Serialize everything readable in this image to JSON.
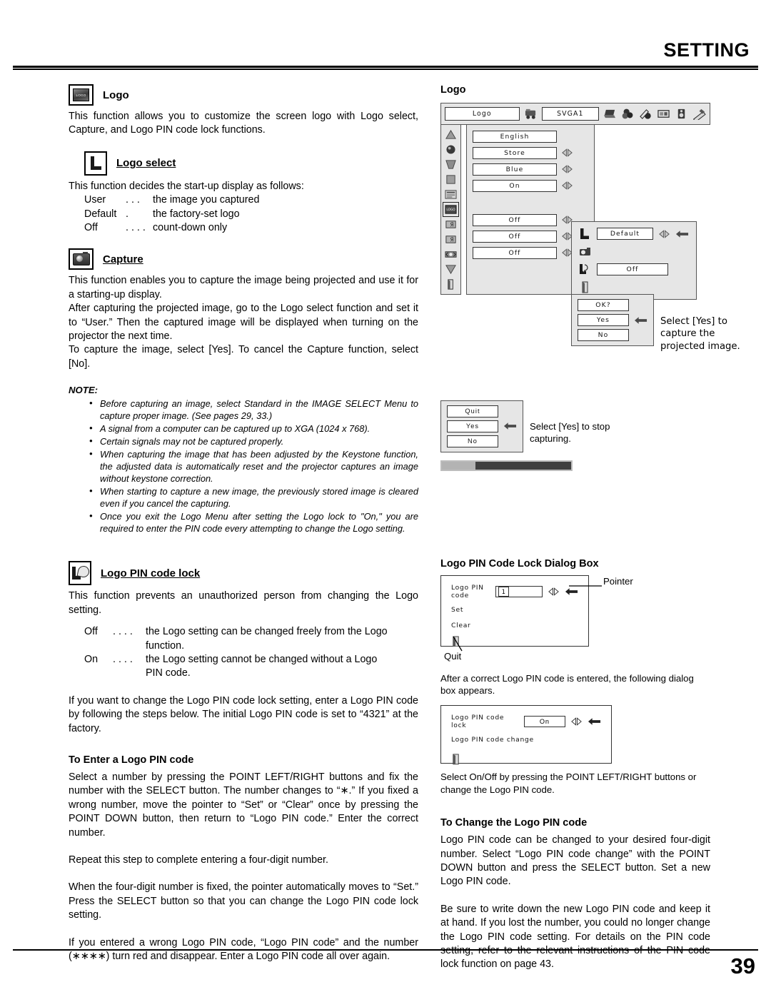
{
  "header": {
    "title": "SETTING"
  },
  "footer": {
    "page_number": "39"
  },
  "left": {
    "logo": {
      "icon": "logo-badge-icon",
      "title": "Logo",
      "paragraph": "This function allows you to customize the screen logo with Logo select, Capture, and Logo PIN code lock functions."
    },
    "logo_select": {
      "icon": "logo-select-L-icon",
      "title": "Logo select",
      "intro": "This function decides the start-up display as follows:",
      "options": [
        {
          "key": "User",
          "dots": ". . .",
          "desc": "the image you captured"
        },
        {
          "key": "Default",
          "dots": ".",
          "desc": "the factory-set logo"
        },
        {
          "key": "Off",
          "dots": ". . . .",
          "desc": "count-down only"
        }
      ]
    },
    "capture": {
      "icon": "camera-icon",
      "title": "Capture",
      "paragraphs": [
        "This function enables you to capture the image being projected and use it for a starting-up display.",
        "After capturing the projected image, go to the Logo select function and set it to “User.” Then the captured image will be displayed when turning on the projector the next time.",
        "To capture the image, select [Yes]. To cancel the Capture function, select [No]."
      ]
    },
    "note": {
      "title": "NOTE:",
      "items": [
        "Before capturing an image, select Standard in the IMAGE SELECT Menu to capture proper image. (See pages 29, 33.)",
        "A signal from a computer can be captured up to XGA (1024 x 768).",
        "Certain signals may not be captured properly.",
        "When capturing the image that has been adjusted by the Keystone function, the adjusted data is automatically reset and the projector captures an image without keystone correction.",
        "When starting to capture a new image, the previously stored image is cleared even if you cancel the capturing.",
        "Once you exit the Logo Menu after setting the Logo lock to \"On,\" you are required to enter the PIN code every attempting to change the Logo setting."
      ]
    },
    "pin_lock": {
      "icon": "logo-pin-code-lock-icon",
      "title": "Logo PIN code lock",
      "paragraph": "This function prevents an unauthorized person from changing the Logo setting.",
      "options": [
        {
          "key": "Off",
          "dots": ". . . .",
          "desc": "the Logo setting can be changed freely from the Logo",
          "cont": "function."
        },
        {
          "key": "On",
          "dots": ". . . .",
          "desc": "the Logo setting cannot be changed without a Logo",
          "cont": "PIN code."
        }
      ],
      "paragraph2": "If you want to change the Logo PIN code lock setting, enter a Logo PIN code by following the steps below. The initial Logo PIN code is set to “4321” at the factory."
    },
    "enter_pin": {
      "title": "To Enter a Logo PIN code",
      "paragraphs": [
        "Select a number by pressing the POINT LEFT/RIGHT buttons and fix the number with the SELECT button. The number changes to “∗.” If you fixed a wrong number, move the pointer to “Set” or “Clear” once by pressing the POINT DOWN button, then return to “Logo PIN code.” Enter the correct number.",
        "Repeat this step to complete entering a four-digit number.",
        "When the four-digit number is fixed, the pointer automatically moves to “Set.” Press the SELECT button so that you can change the Logo PIN code lock setting.",
        "If you entered a wrong Logo PIN code, “Logo PIN code” and the number (∗∗∗∗) turn red and disappear. Enter a Logo PIN code all over again."
      ]
    }
  },
  "right": {
    "osd_caption": "Logo",
    "osd": {
      "topbar": {
        "menu_title": "Logo",
        "source": "SVGA1",
        "icons": [
          "projector-icon",
          "computer-icon",
          "color-icon",
          "image-adjust-icon",
          "screen-icon",
          "sound-icon",
          "setting-icon"
        ]
      },
      "rail_icons": [
        "up-arrow-icon",
        "language-globe-icon",
        "keystone-icon",
        "background-icon",
        "display-icon",
        "logo-icon",
        "ceiling-icon",
        "rear-icon",
        "terminal-icon",
        "down-arrow-icon",
        "quit-icon"
      ],
      "rows": [
        {
          "value": "English",
          "arrows": false
        },
        {
          "value": "Store",
          "arrows": true
        },
        {
          "value": "Blue",
          "arrows": true
        },
        {
          "value": "On",
          "arrows": true
        },
        {
          "value": "Off",
          "arrows": true
        },
        {
          "value": "Off",
          "arrows": true
        },
        {
          "value": "Off",
          "arrows": true
        }
      ],
      "sub_dialog": {
        "rows": [
          {
            "icon": "logo-select-L-icon",
            "value": "Default",
            "arrows": true,
            "pointer": true
          },
          {
            "icon": "camera-icon",
            "value": "",
            "arrows": false,
            "pointer": false
          },
          {
            "icon": "logo-pin-code-lock-icon",
            "value": "Off",
            "arrows": false,
            "pointer": false
          },
          {
            "icon": "quit-icon",
            "value": "",
            "arrows": false,
            "pointer": false
          }
        ]
      },
      "ok_dialog": {
        "title": "OK?",
        "yes": "Yes",
        "no": "No",
        "pointer": true,
        "note": "Select [Yes] to capture the projected image."
      },
      "quit_dialog": {
        "title": "Quit",
        "yes": "Yes",
        "no": "No",
        "pointer": true,
        "note": "Select [Yes] to stop capturing."
      },
      "progress_percent": 26
    },
    "pin_dialog_section": {
      "heading": "Logo PIN Code Lock Dialog Box",
      "dialog": {
        "field_label": "Logo PIN code",
        "field_value": "1",
        "rows": [
          "Set",
          "Clear"
        ],
        "quit_icon": "quit-icon"
      },
      "pointer_label": "Pointer",
      "quit_label": "Quit"
    },
    "after_pin": {
      "paragraph": "After a correct Logo PIN code is entered, the following dialog box appears.",
      "dialog": {
        "row1_label": "Logo PIN code lock",
        "row1_value": "On",
        "row2_label": "Logo PIN code change",
        "quit_icon": "quit-icon"
      },
      "paragraph2": "Select On/Off by pressing the POINT LEFT/RIGHT buttons or change the Logo PIN code."
    },
    "change_pin": {
      "title": "To Change the Logo PIN code",
      "paragraphs": [
        "Logo PIN code can be changed to your desired four-digit number. Select “Logo PIN code change” with the POINT DOWN button and press the SELECT button. Set a new Logo PIN code.",
        "Be sure to write down the new Logo PIN code and keep it at hand. If you lost the number, you could no longer change the Logo PIN code setting. For details on the PIN code setting, refer to the relevant instructions of the PIN code lock function on page 43."
      ]
    }
  }
}
